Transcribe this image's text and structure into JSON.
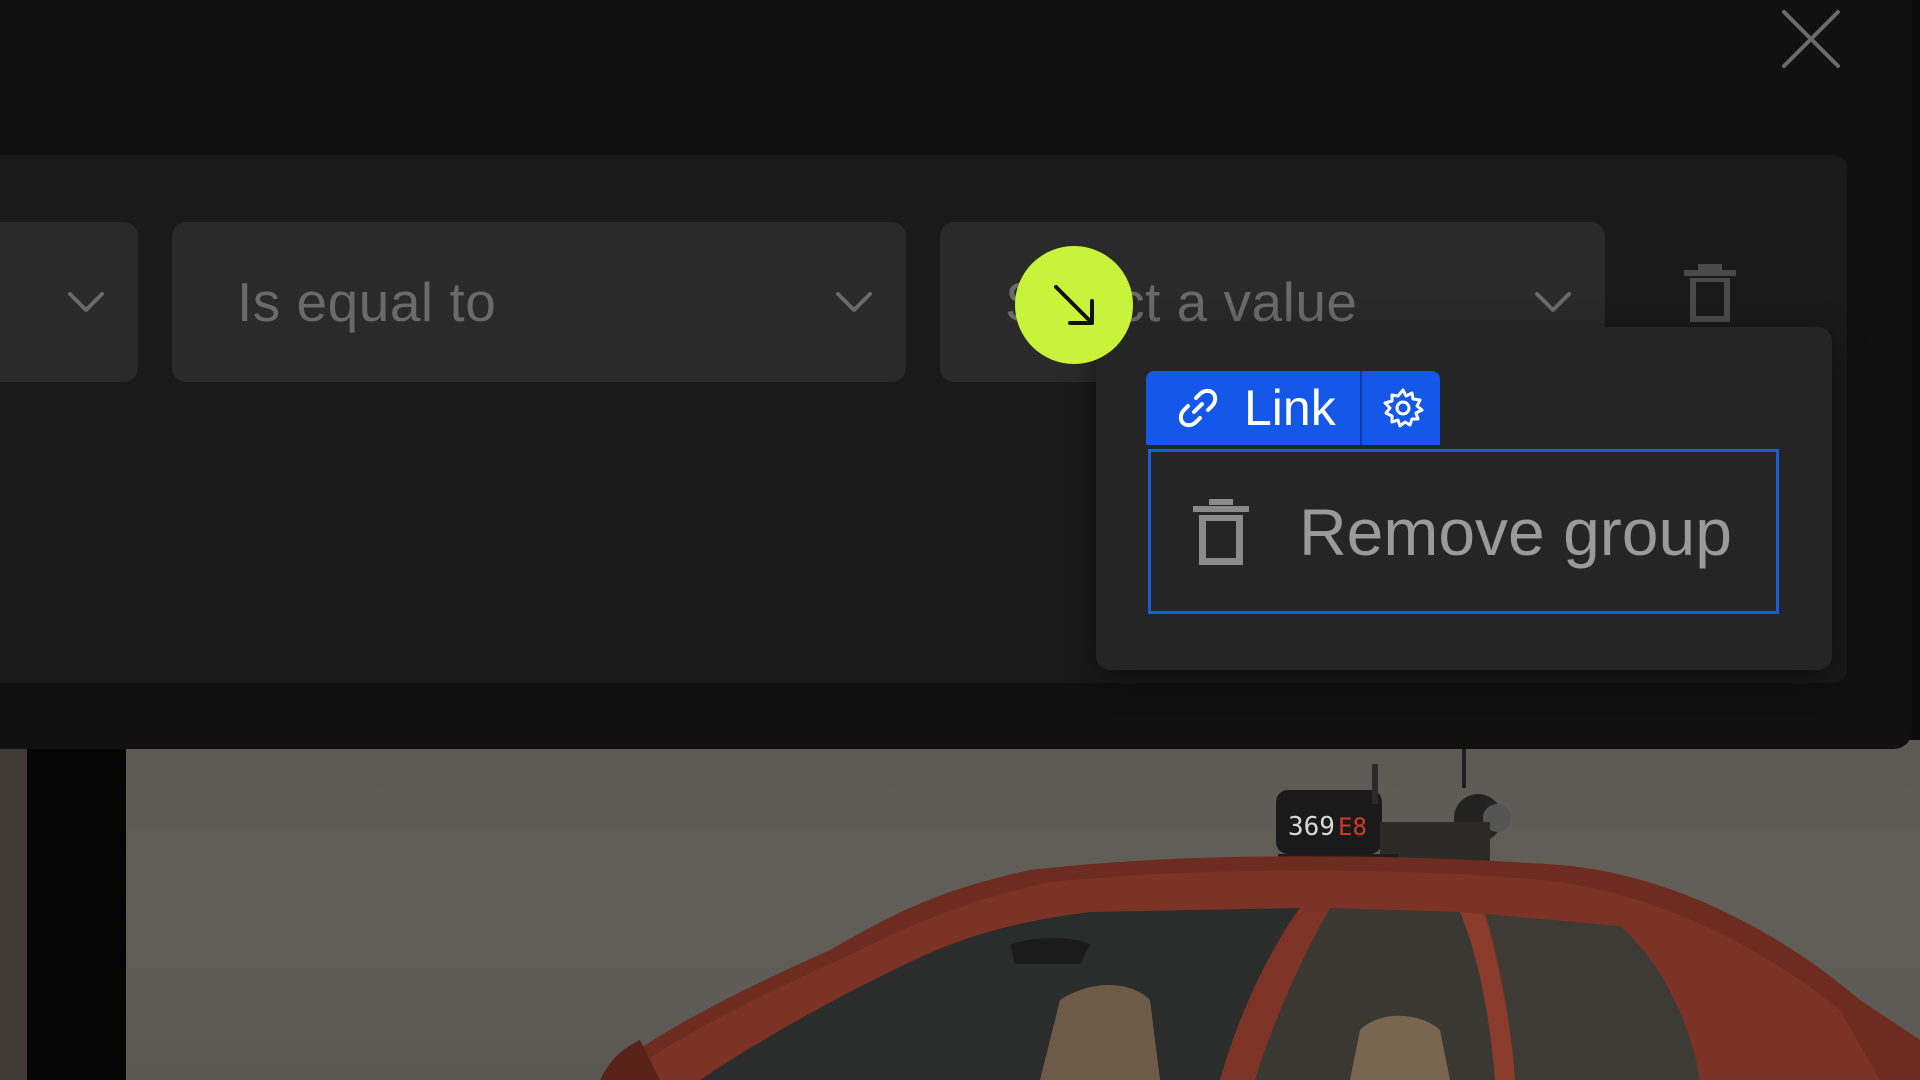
{
  "background": {
    "scoreboard_text": "369",
    "scoreboard_text_right": "E8"
  },
  "dialog": {
    "close_icon": "close-icon",
    "filter": {
      "field_icon": "chevron-down-icon",
      "operator_label": "Is equal to",
      "value_placeholder": "Select a value",
      "remove_row_icon": "trash-icon"
    }
  },
  "popover": {
    "link_badge": {
      "label": "Link",
      "link_icon": "link-icon",
      "settings_icon": "gear-icon",
      "color": "#1557e8"
    },
    "menu": {
      "remove_group_label": "Remove group",
      "remove_group_icon": "trash-icon",
      "focus_color": "#1e5bd6"
    }
  },
  "cursor": {
    "icon": "arrow-down-right-icon",
    "color": "#c9f23a"
  }
}
